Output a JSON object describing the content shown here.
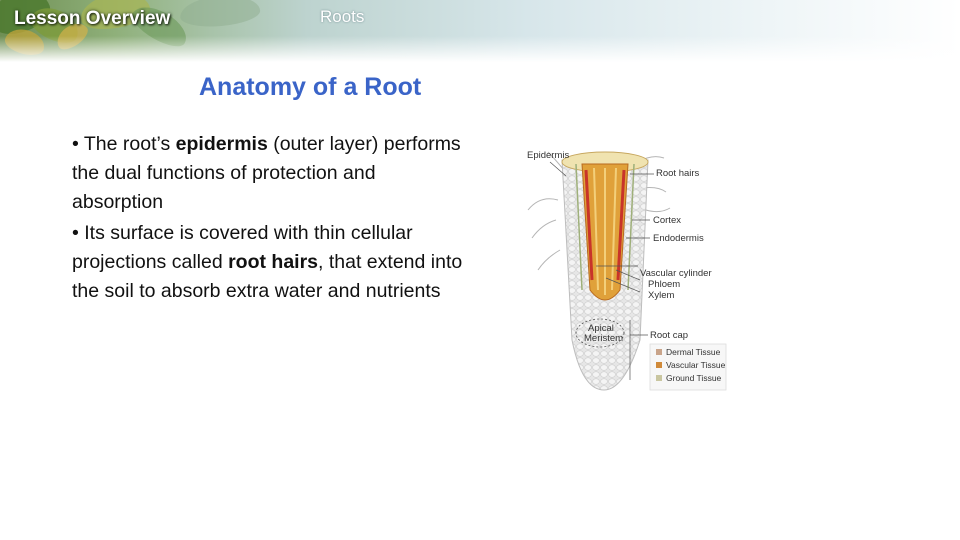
{
  "header": {
    "lesson_label": "Lesson Overview",
    "topic": "Roots"
  },
  "slide": {
    "title": "Anatomy of a Root",
    "bullets": [
      {
        "prefix": "• The root’s ",
        "bold": "epidermis",
        "suffix": " (outer layer) performs the dual functions of protection and absorption"
      },
      {
        "prefix": "• Its surface is covered with thin cellular projections called ",
        "bold": "root hairs",
        "suffix": ", that extend into the soil to absorb extra water and nutrients"
      }
    ]
  },
  "figure": {
    "labels": {
      "epidermis": "Epidermis",
      "root_hairs": "Root hairs",
      "cortex": "Cortex",
      "endodermis": "Endodermis",
      "vascular_cylinder": "Vascular cylinder",
      "phloem": "Phloem",
      "xylem": "Xylem",
      "root_cap": "Root cap",
      "apical_meristem_1": "Apical",
      "apical_meristem_2": "Meristem"
    },
    "legend": [
      {
        "label": "Dermal Tissue",
        "color": "#c9a48a"
      },
      {
        "label": "Vascular Tissue",
        "color": "#d08a3a"
      },
      {
        "label": "Ground Tissue",
        "color": "#c9c6a0"
      }
    ]
  }
}
